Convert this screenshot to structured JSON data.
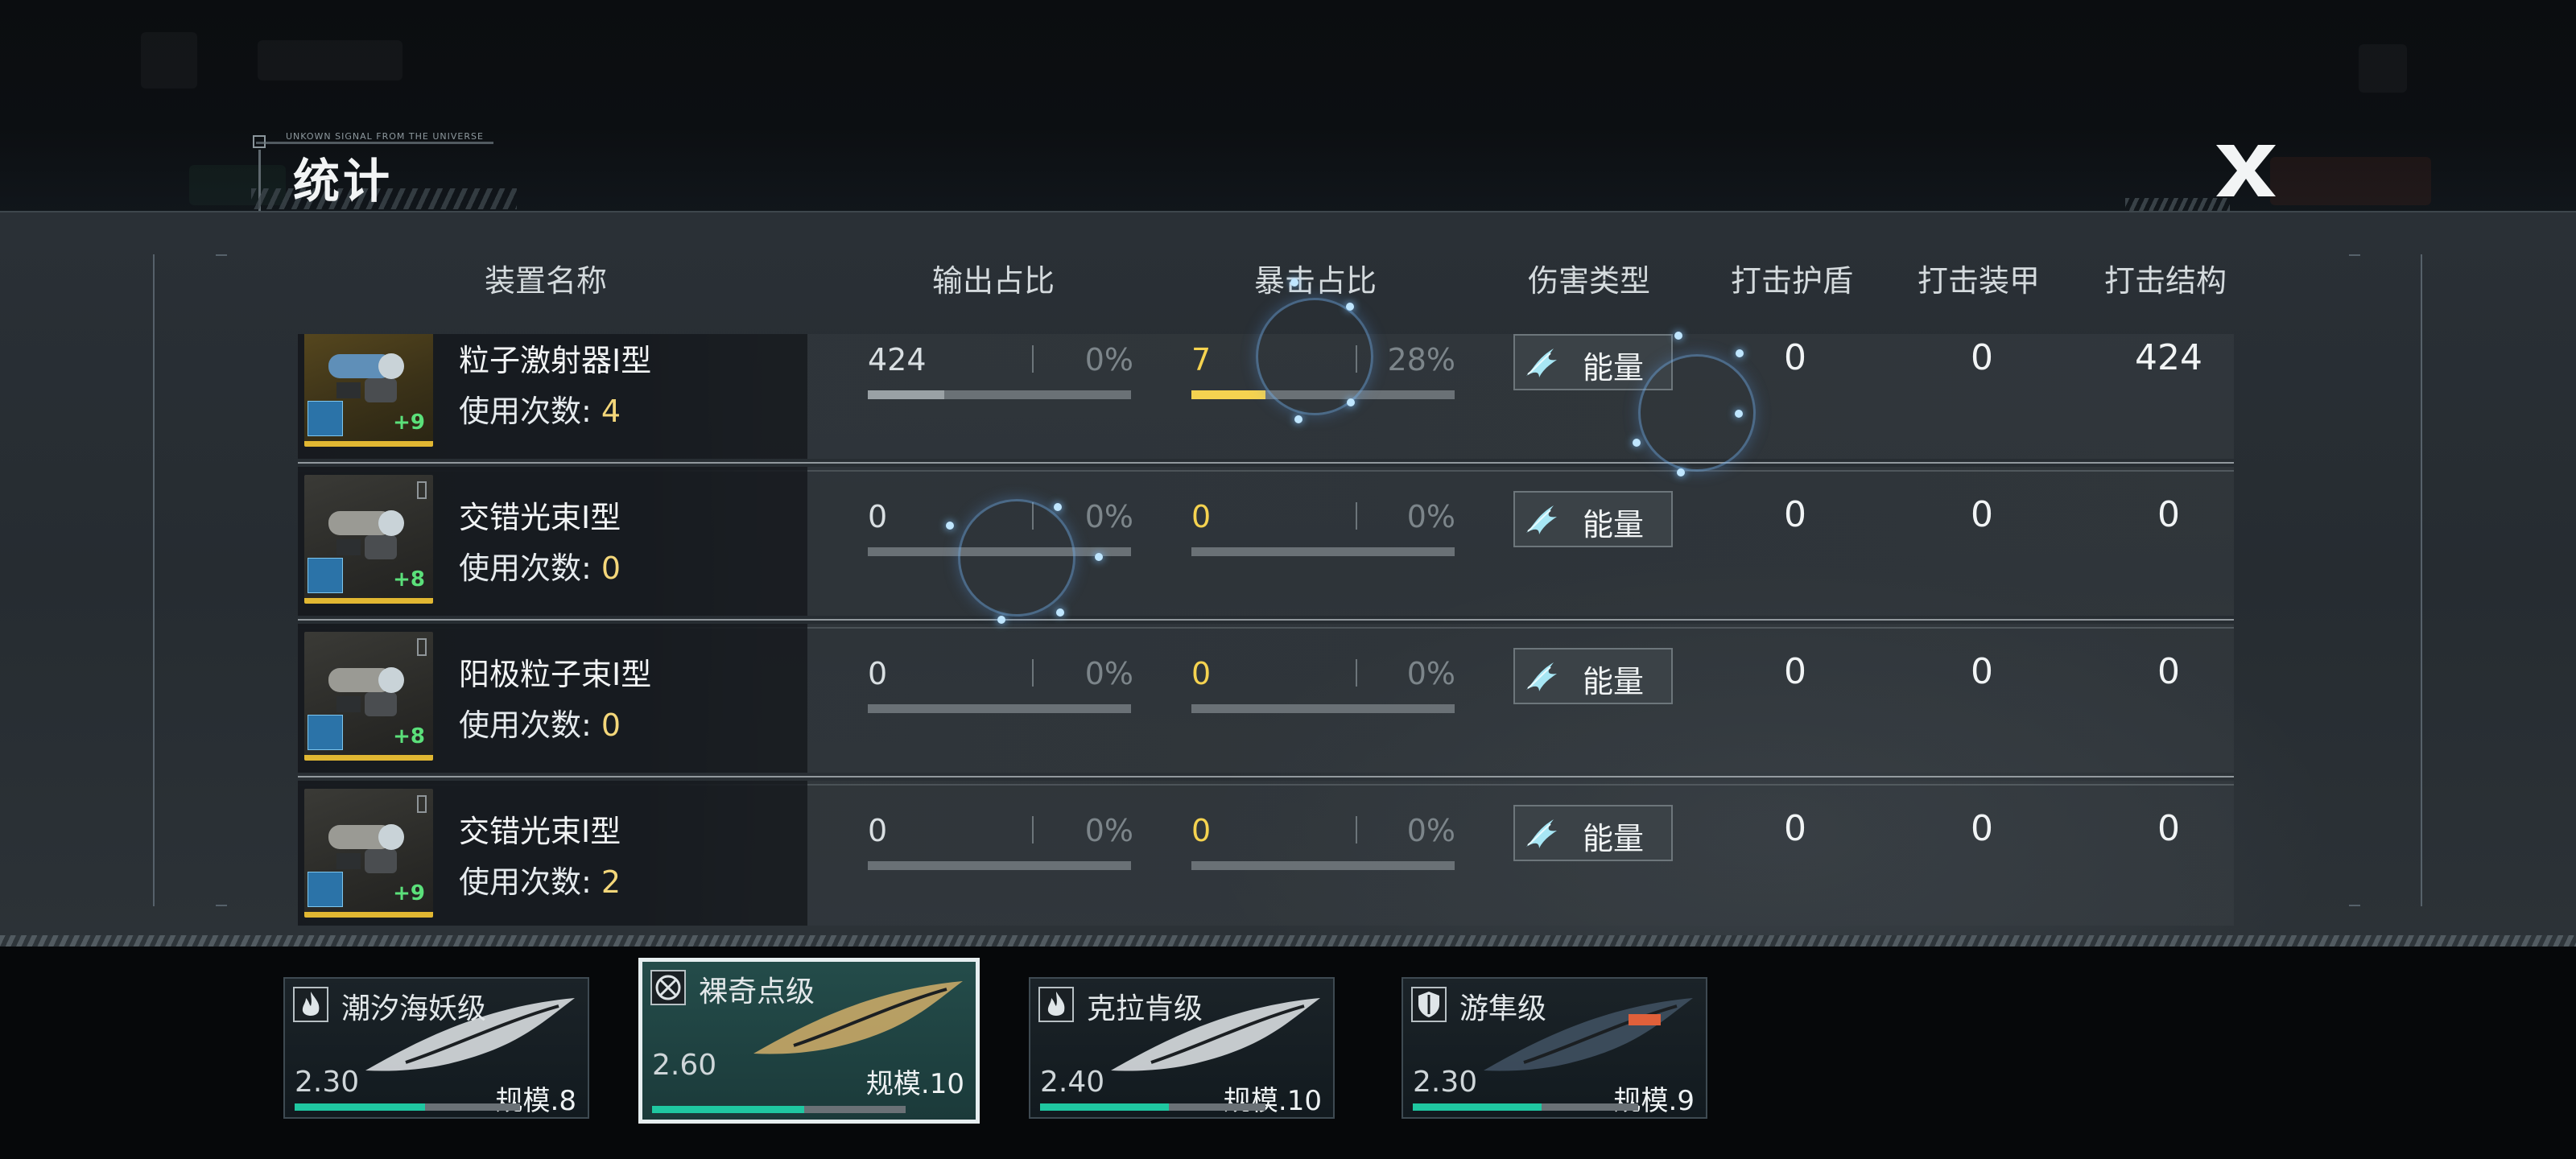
{
  "title": "统计",
  "title_deco": "UNKOWN SIGNAL FROM THE UNIVERSE",
  "close_label": "X",
  "headers": {
    "name": "装置名称",
    "output_ratio": "输出占比",
    "crit_ratio": "暴击占比",
    "damage_type": "伤害类型",
    "hit_shield": "打击护盾",
    "hit_armor": "打击装甲",
    "hit_structure": "打击结构"
  },
  "rows": [
    {
      "name": "粒子激射器I型",
      "use_label": "使用次数:",
      "use_count": "4",
      "level": "+9",
      "output_value": "424",
      "output_pct": "0%",
      "output_fill": 0.29,
      "crit_value": "7",
      "crit_pct": "28%",
      "crit_fill": 0.28,
      "damage_type": "能量",
      "shield": "0",
      "armor": "0",
      "structure": "424"
    },
    {
      "name": "交错光束I型",
      "use_label": "使用次数:",
      "use_count": "0",
      "level": "+8",
      "output_value": "0",
      "output_pct": "0%",
      "output_fill": 0,
      "crit_value": "0",
      "crit_pct": "0%",
      "crit_fill": 0,
      "damage_type": "能量",
      "shield": "0",
      "armor": "0",
      "structure": "0"
    },
    {
      "name": "阳极粒子束I型",
      "use_label": "使用次数:",
      "use_count": "0",
      "level": "+8",
      "output_value": "0",
      "output_pct": "0%",
      "output_fill": 0,
      "crit_value": "0",
      "crit_pct": "0%",
      "crit_fill": 0,
      "damage_type": "能量",
      "shield": "0",
      "armor": "0",
      "structure": "0"
    },
    {
      "name": "交错光束I型",
      "use_label": "使用次数:",
      "use_count": "2",
      "level": "+9",
      "output_value": "0",
      "output_pct": "0%",
      "output_fill": 0,
      "crit_value": "0",
      "crit_pct": "0%",
      "crit_fill": 0,
      "damage_type": "能量",
      "shield": "0",
      "armor": "0",
      "structure": "0"
    }
  ],
  "ships": [
    {
      "name": "潮汐海妖级",
      "power": "2.30",
      "scale": "规模.8",
      "hp": 0.58,
      "icon": "flame-icon",
      "selected": false
    },
    {
      "name": "裸奇点级",
      "power": "2.60",
      "scale": "规模.10",
      "hp": 0.6,
      "icon": "target-icon",
      "selected": true
    },
    {
      "name": "克拉肯级",
      "power": "2.40",
      "scale": "规模.10",
      "hp": 0.57,
      "icon": "flame-icon",
      "selected": false
    },
    {
      "name": "游隼级",
      "power": "2.30",
      "scale": "规模.9",
      "hp": 0.57,
      "icon": "shield-icon",
      "selected": false
    }
  ],
  "colors": {
    "crit_yellow": "#f5d350",
    "hp_teal": "#1fc7a1",
    "gold_frame": "#e1b732"
  }
}
